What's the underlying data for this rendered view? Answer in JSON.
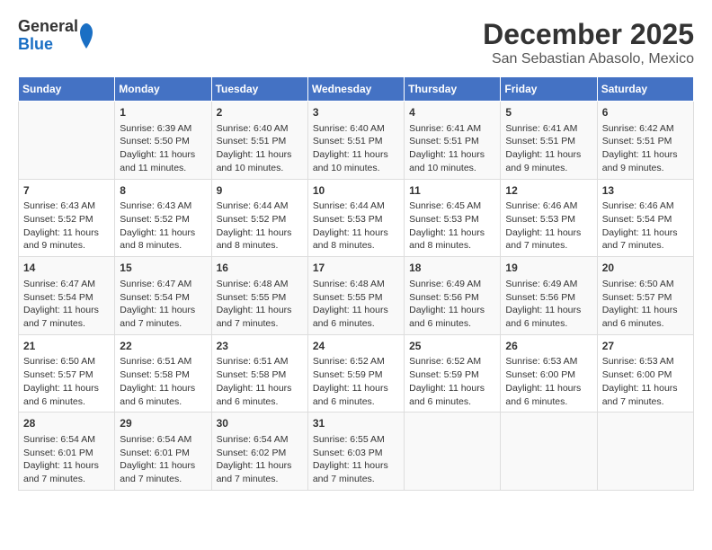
{
  "header": {
    "logo_general": "General",
    "logo_blue": "Blue",
    "title": "December 2025",
    "subtitle": "San Sebastian Abasolo, Mexico"
  },
  "days_of_week": [
    "Sunday",
    "Monday",
    "Tuesday",
    "Wednesday",
    "Thursday",
    "Friday",
    "Saturday"
  ],
  "weeks": [
    [
      {
        "day": "",
        "info": ""
      },
      {
        "day": "1",
        "info": "Sunrise: 6:39 AM\nSunset: 5:50 PM\nDaylight: 11 hours\nand 11 minutes."
      },
      {
        "day": "2",
        "info": "Sunrise: 6:40 AM\nSunset: 5:51 PM\nDaylight: 11 hours\nand 10 minutes."
      },
      {
        "day": "3",
        "info": "Sunrise: 6:40 AM\nSunset: 5:51 PM\nDaylight: 11 hours\nand 10 minutes."
      },
      {
        "day": "4",
        "info": "Sunrise: 6:41 AM\nSunset: 5:51 PM\nDaylight: 11 hours\nand 10 minutes."
      },
      {
        "day": "5",
        "info": "Sunrise: 6:41 AM\nSunset: 5:51 PM\nDaylight: 11 hours\nand 9 minutes."
      },
      {
        "day": "6",
        "info": "Sunrise: 6:42 AM\nSunset: 5:51 PM\nDaylight: 11 hours\nand 9 minutes."
      }
    ],
    [
      {
        "day": "7",
        "info": "Sunrise: 6:43 AM\nSunset: 5:52 PM\nDaylight: 11 hours\nand 9 minutes."
      },
      {
        "day": "8",
        "info": "Sunrise: 6:43 AM\nSunset: 5:52 PM\nDaylight: 11 hours\nand 8 minutes."
      },
      {
        "day": "9",
        "info": "Sunrise: 6:44 AM\nSunset: 5:52 PM\nDaylight: 11 hours\nand 8 minutes."
      },
      {
        "day": "10",
        "info": "Sunrise: 6:44 AM\nSunset: 5:53 PM\nDaylight: 11 hours\nand 8 minutes."
      },
      {
        "day": "11",
        "info": "Sunrise: 6:45 AM\nSunset: 5:53 PM\nDaylight: 11 hours\nand 8 minutes."
      },
      {
        "day": "12",
        "info": "Sunrise: 6:46 AM\nSunset: 5:53 PM\nDaylight: 11 hours\nand 7 minutes."
      },
      {
        "day": "13",
        "info": "Sunrise: 6:46 AM\nSunset: 5:54 PM\nDaylight: 11 hours\nand 7 minutes."
      }
    ],
    [
      {
        "day": "14",
        "info": "Sunrise: 6:47 AM\nSunset: 5:54 PM\nDaylight: 11 hours\nand 7 minutes."
      },
      {
        "day": "15",
        "info": "Sunrise: 6:47 AM\nSunset: 5:54 PM\nDaylight: 11 hours\nand 7 minutes."
      },
      {
        "day": "16",
        "info": "Sunrise: 6:48 AM\nSunset: 5:55 PM\nDaylight: 11 hours\nand 7 minutes."
      },
      {
        "day": "17",
        "info": "Sunrise: 6:48 AM\nSunset: 5:55 PM\nDaylight: 11 hours\nand 6 minutes."
      },
      {
        "day": "18",
        "info": "Sunrise: 6:49 AM\nSunset: 5:56 PM\nDaylight: 11 hours\nand 6 minutes."
      },
      {
        "day": "19",
        "info": "Sunrise: 6:49 AM\nSunset: 5:56 PM\nDaylight: 11 hours\nand 6 minutes."
      },
      {
        "day": "20",
        "info": "Sunrise: 6:50 AM\nSunset: 5:57 PM\nDaylight: 11 hours\nand 6 minutes."
      }
    ],
    [
      {
        "day": "21",
        "info": "Sunrise: 6:50 AM\nSunset: 5:57 PM\nDaylight: 11 hours\nand 6 minutes."
      },
      {
        "day": "22",
        "info": "Sunrise: 6:51 AM\nSunset: 5:58 PM\nDaylight: 11 hours\nand 6 minutes."
      },
      {
        "day": "23",
        "info": "Sunrise: 6:51 AM\nSunset: 5:58 PM\nDaylight: 11 hours\nand 6 minutes."
      },
      {
        "day": "24",
        "info": "Sunrise: 6:52 AM\nSunset: 5:59 PM\nDaylight: 11 hours\nand 6 minutes."
      },
      {
        "day": "25",
        "info": "Sunrise: 6:52 AM\nSunset: 5:59 PM\nDaylight: 11 hours\nand 6 minutes."
      },
      {
        "day": "26",
        "info": "Sunrise: 6:53 AM\nSunset: 6:00 PM\nDaylight: 11 hours\nand 6 minutes."
      },
      {
        "day": "27",
        "info": "Sunrise: 6:53 AM\nSunset: 6:00 PM\nDaylight: 11 hours\nand 7 minutes."
      }
    ],
    [
      {
        "day": "28",
        "info": "Sunrise: 6:54 AM\nSunset: 6:01 PM\nDaylight: 11 hours\nand 7 minutes."
      },
      {
        "day": "29",
        "info": "Sunrise: 6:54 AM\nSunset: 6:01 PM\nDaylight: 11 hours\nand 7 minutes."
      },
      {
        "day": "30",
        "info": "Sunrise: 6:54 AM\nSunset: 6:02 PM\nDaylight: 11 hours\nand 7 minutes."
      },
      {
        "day": "31",
        "info": "Sunrise: 6:55 AM\nSunset: 6:03 PM\nDaylight: 11 hours\nand 7 minutes."
      },
      {
        "day": "",
        "info": ""
      },
      {
        "day": "",
        "info": ""
      },
      {
        "day": "",
        "info": ""
      }
    ]
  ]
}
